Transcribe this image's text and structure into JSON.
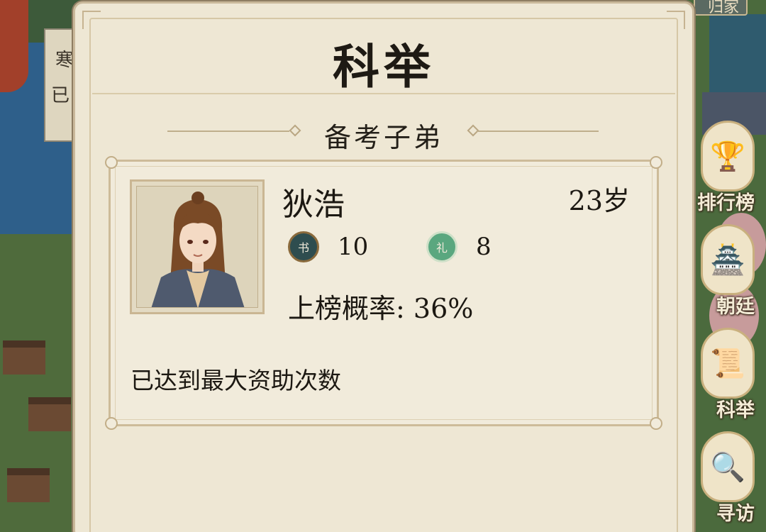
{
  "background": {
    "plank_chars": [
      "寒",
      "已"
    ],
    "top_button_label": "归家"
  },
  "side_menu": [
    {
      "label": "排行榜",
      "icon": "trophy-icon",
      "glyph": "🏆"
    },
    {
      "label": "朝廷",
      "icon": "palace-icon",
      "glyph": "🏯"
    },
    {
      "label": "科举",
      "icon": "scroll-book-icon",
      "glyph": "📜"
    },
    {
      "label": "寻访",
      "icon": "magnifier-icon",
      "glyph": "🔍"
    }
  ],
  "panel": {
    "title": "科举",
    "section_title": "备考子弟"
  },
  "student": {
    "name": "狄浩",
    "age": "23岁",
    "book_badge": "书",
    "book_value": "10",
    "rite_badge": "礼",
    "rite_value": "8",
    "prob_label": "上榜概率:",
    "prob_value": "36%",
    "status_msg": "已达到最大资助次数"
  },
  "colors": {
    "panel_bg": "#eee7d4",
    "frame": "#c9b89a",
    "text": "#1c1812",
    "book_badge": "#2e4d4f",
    "rite_badge": "#5aa77f"
  }
}
